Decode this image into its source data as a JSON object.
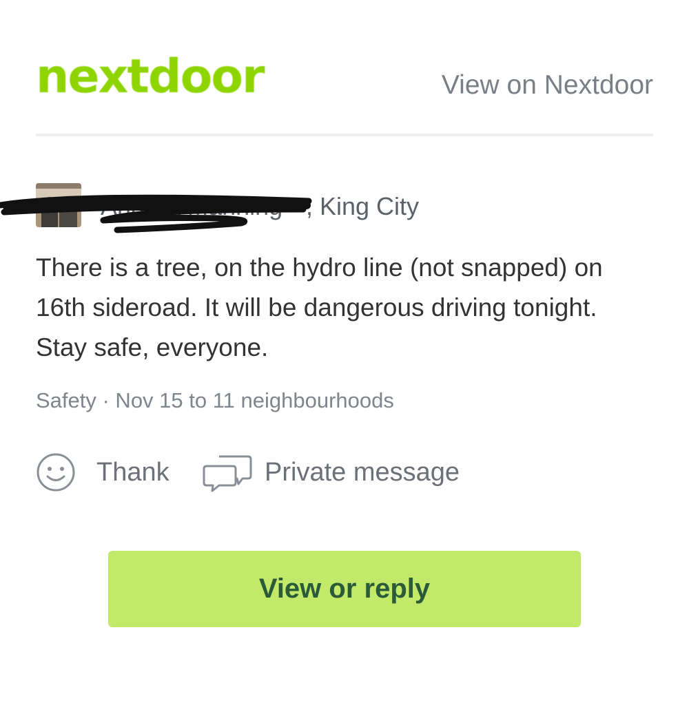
{
  "header": {
    "logo_text": "nextdoor",
    "view_link": "View on Nextdoor"
  },
  "post": {
    "author": {
      "name": "Andrea Manning",
      "location": ", King City",
      "name_redacted": true
    },
    "body": "There is a tree, on the hydro line (not snapped) on 16th sideroad. It will be dangerous driving tonight. Stay safe, everyone.",
    "meta": "Safety · Nov 15 to 11 neighbourhoods"
  },
  "actions": {
    "thank_label": "Thank",
    "thank_icon": "smiley-icon",
    "message_label": "Private message",
    "message_icon": "chat-bubbles-icon"
  },
  "cta": {
    "label": "View or reply"
  },
  "colors": {
    "brand_green": "#8ed500",
    "button_bg": "#c2e96a",
    "button_text": "#2a5a38",
    "muted_text": "#7a7e86",
    "body_text": "#333333"
  }
}
